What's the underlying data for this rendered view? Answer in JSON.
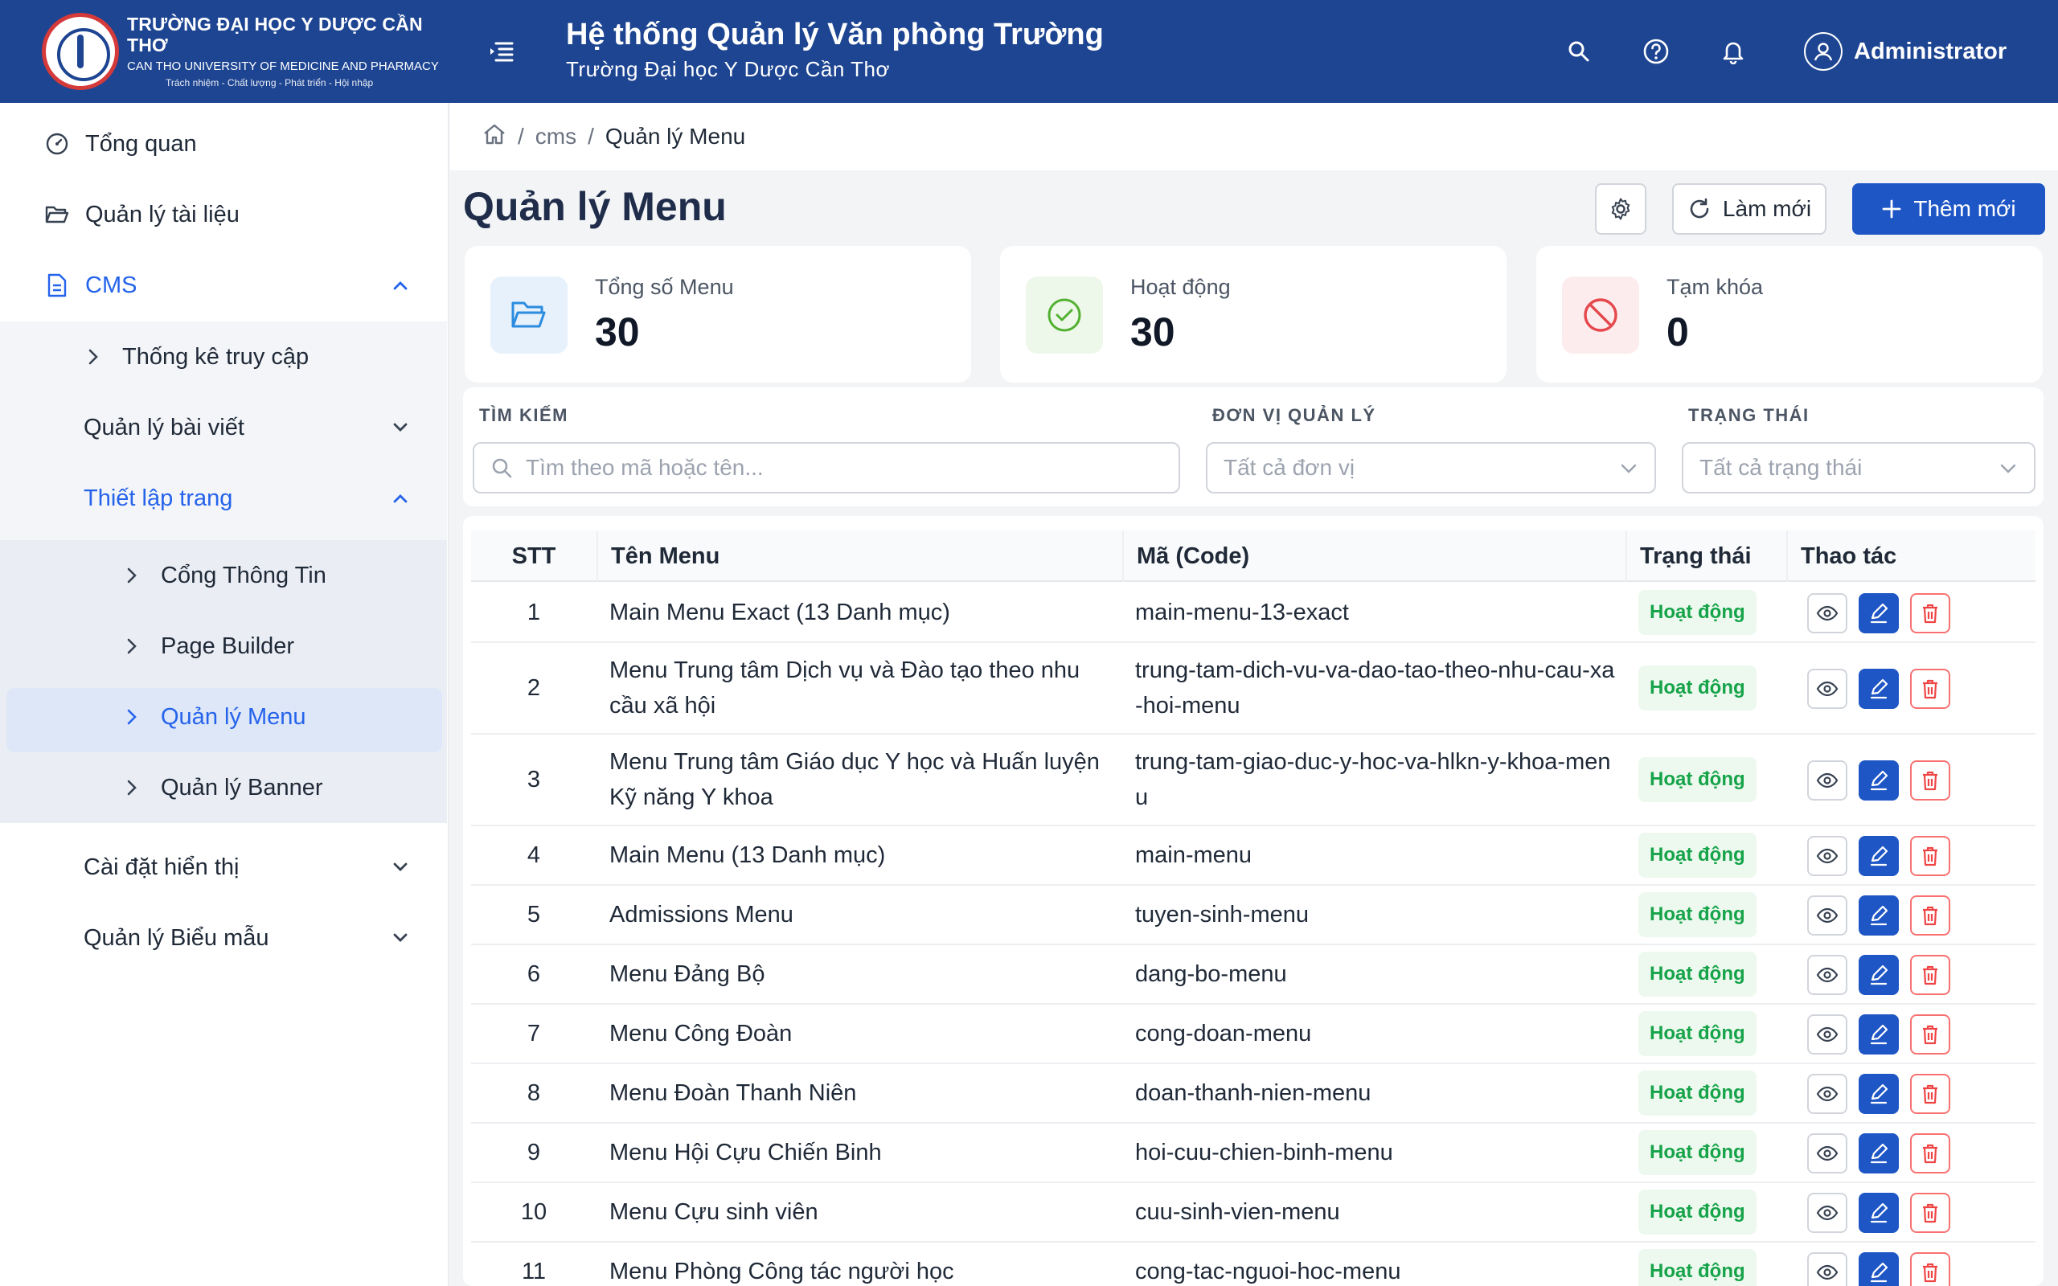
{
  "header": {
    "brand_line1": "TRƯỜNG ĐẠI HỌC Y DƯỢC CẦN THƠ",
    "brand_line2": "CAN THO UNIVERSITY OF MEDICINE AND PHARMACY",
    "brand_line3": "Trách nhiệm - Chất lượng - Phát triển - Hội nhập",
    "title": "Hệ thống Quản lý Văn phòng Trường",
    "subtitle": "Trường Đại học Y Dược Cần Thơ",
    "user_name": "Administrator"
  },
  "sidebar": {
    "overview": "Tổng quan",
    "documents": "Quản lý tài liệu",
    "cms": "CMS",
    "access_stats": "Thống kê truy cập",
    "posts": "Quản lý bài viết",
    "page_setup": "Thiết lập trang",
    "portal": "Cổng Thông Tin",
    "page_builder": "Page Builder",
    "menu_mgmt": "Quản lý Menu",
    "banner_mgmt": "Quản lý Banner",
    "display_settings": "Cài đặt hiển thị",
    "form_mgmt": "Quản lý Biểu mẫu"
  },
  "breadcrumb": {
    "section": "cms",
    "current": "Quản lý Menu"
  },
  "page": {
    "title": "Quản lý Menu",
    "refresh_label": "Làm mới",
    "add_label": "Thêm mới"
  },
  "stats": {
    "total_label": "Tổng số Menu",
    "total_value": "30",
    "active_label": "Hoạt động",
    "active_value": "30",
    "locked_label": "Tạm khóa",
    "locked_value": "0"
  },
  "filters": {
    "search_label": "TÌM KIẾM",
    "search_placeholder": "Tìm theo mã hoặc tên...",
    "unit_label": "ĐƠN VỊ QUẢN LÝ",
    "unit_value": "Tất cả đơn vị",
    "status_label": "TRẠNG THÁI",
    "status_value": "Tất cả trạng thái"
  },
  "table": {
    "headers": {
      "stt": "STT",
      "name": "Tên Menu",
      "code": "Mã (Code)",
      "status": "Trạng thái",
      "actions": "Thao tác"
    },
    "rows": [
      {
        "stt": "1",
        "name": "Main Menu Exact (13 Danh mục)",
        "code": "main-menu-13-exact",
        "status": "Hoạt động"
      },
      {
        "stt": "2",
        "name": "Menu Trung tâm Dịch vụ và Đào tạo theo nhu cầu xã hội",
        "code": "trung-tam-dich-vu-va-dao-tao-theo-nhu-cau-xa-hoi-menu",
        "status": "Hoạt động"
      },
      {
        "stt": "3",
        "name": "Menu Trung tâm Giáo dục Y học và Huấn luyện Kỹ năng Y khoa",
        "code": "trung-tam-giao-duc-y-hoc-va-hlkn-y-khoa-menu",
        "status": "Hoạt động"
      },
      {
        "stt": "4",
        "name": "Main Menu (13 Danh mục)",
        "code": "main-menu",
        "status": "Hoạt động"
      },
      {
        "stt": "5",
        "name": "Admissions Menu",
        "code": "tuyen-sinh-menu",
        "status": "Hoạt động"
      },
      {
        "stt": "6",
        "name": "Menu Đảng Bộ",
        "code": "dang-bo-menu",
        "status": "Hoạt động"
      },
      {
        "stt": "7",
        "name": "Menu Công Đoàn",
        "code": "cong-doan-menu",
        "status": "Hoạt động"
      },
      {
        "stt": "8",
        "name": "Menu Đoàn Thanh Niên",
        "code": "doan-thanh-nien-menu",
        "status": "Hoạt động"
      },
      {
        "stt": "9",
        "name": "Menu Hội Cựu Chiến Binh",
        "code": "hoi-cuu-chien-binh-menu",
        "status": "Hoạt động"
      },
      {
        "stt": "10",
        "name": "Menu Cựu sinh viên",
        "code": "cuu-sinh-vien-menu",
        "status": "Hoạt động"
      },
      {
        "stt": "11",
        "name": "Menu Phòng Công tác người học",
        "code": "cong-tac-nguoi-hoc-menu",
        "status": "Hoạt động"
      }
    ]
  }
}
